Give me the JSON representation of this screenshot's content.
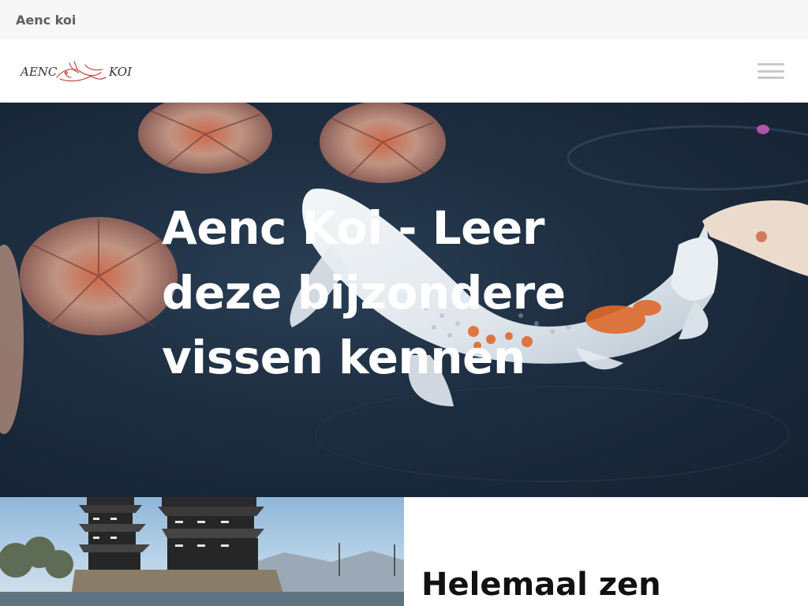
{
  "topbar": {
    "site_name": "Aenc koi"
  },
  "header": {
    "logo_text_left": "AENC",
    "logo_text_right": "KOI",
    "menu_icon": "hamburger-menu-icon"
  },
  "hero": {
    "title": "Aenc Koi - Leer deze bijzondere vissen kennen"
  },
  "section": {
    "heading": "Helemaal zen"
  },
  "colors": {
    "topbar_bg": "#f7f7f7",
    "site_name": "#5a5f66",
    "logo_accent": "#c0392b",
    "hamburger": "#c8c8c8"
  }
}
